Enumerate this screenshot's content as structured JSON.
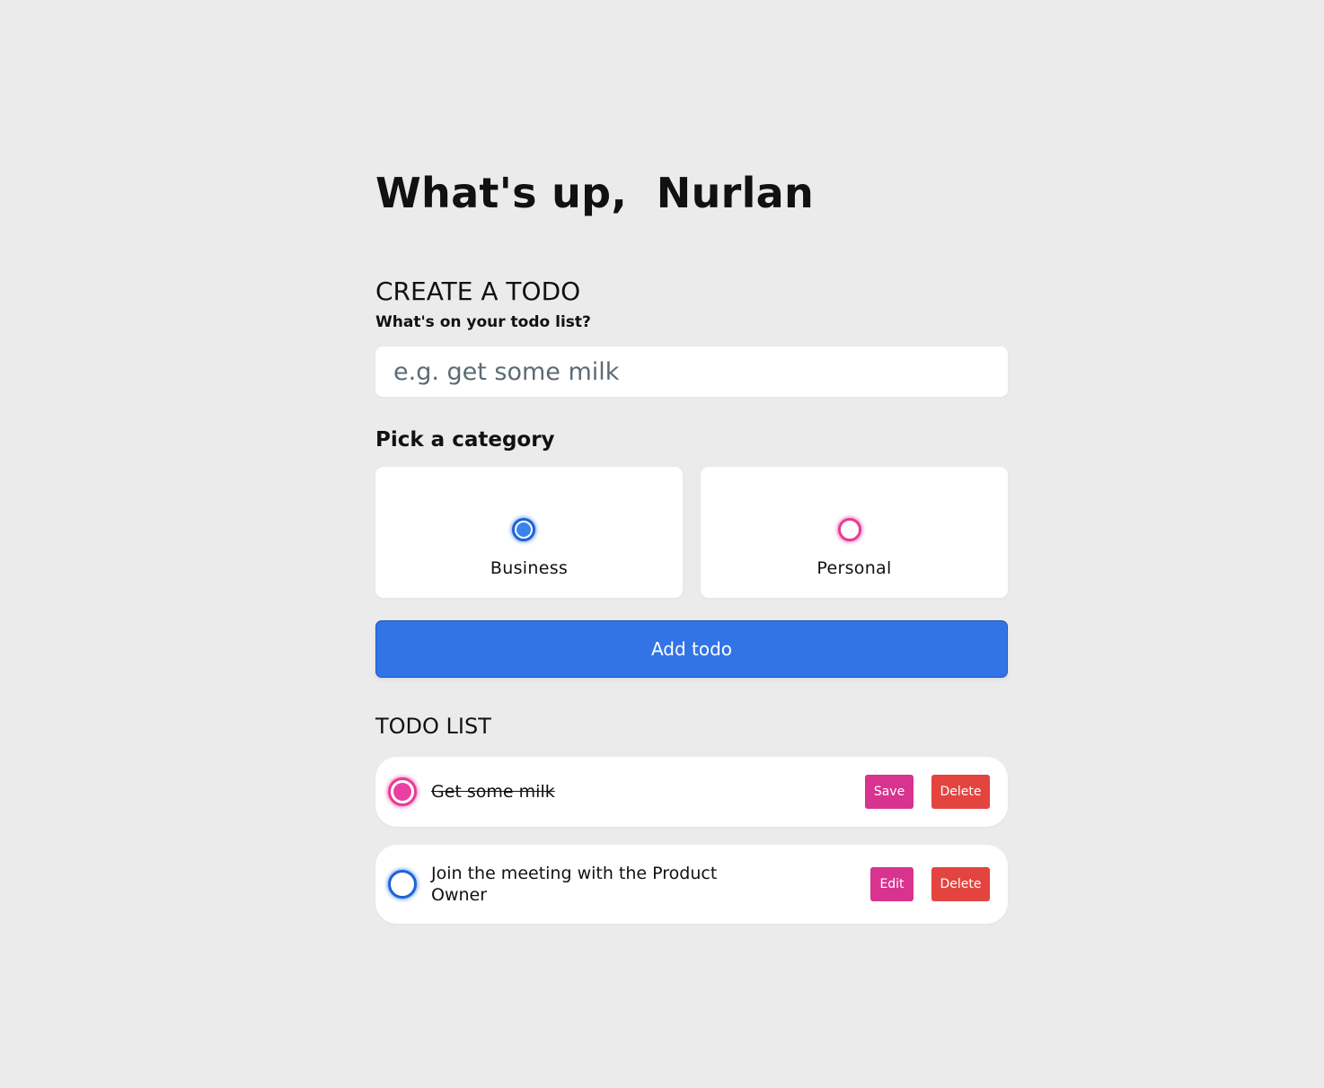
{
  "greeting": {
    "title": "What's up,  Nurlan"
  },
  "create": {
    "section_title": "CREATE A TODO",
    "input_label": "What's on your todo list?",
    "input_placeholder": "e.g. get some milk",
    "input_value": "",
    "category_label": "Pick a category",
    "categories": [
      {
        "label": "Business",
        "selected": true,
        "color": "#3a82ee"
      },
      {
        "label": "Personal",
        "selected": false,
        "color": "#ea40a4"
      }
    ],
    "submit_label": "Add todo",
    "submit_color": "#3274e6"
  },
  "todo_list": {
    "section_title": "TODO LIST",
    "items": [
      {
        "text": "Get some milk",
        "category": "Personal",
        "done": true,
        "primary_action": "Save",
        "secondary_action": "Delete"
      },
      {
        "text": "Join the meeting with the Product Owner",
        "category": "Business",
        "done": false,
        "primary_action": "Edit",
        "secondary_action": "Delete"
      }
    ]
  },
  "colors": {
    "background": "#ebebeb",
    "business": "#3a82ee",
    "personal": "#ea40a4",
    "edit_button": "#d8338f",
    "delete_button": "#e3443f"
  }
}
